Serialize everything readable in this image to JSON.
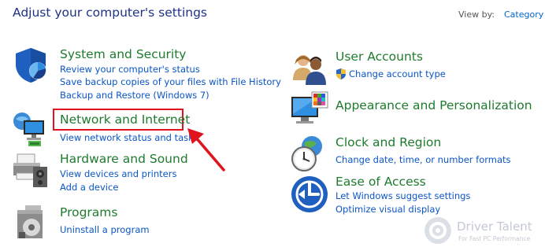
{
  "header": {
    "title": "Adjust your computer's settings",
    "view_by_label": "View by:",
    "view_by_value": "Category"
  },
  "left_categories": [
    {
      "title": "System and Security",
      "links": [
        "Review your computer's status",
        "Save backup copies of your files with File History",
        "Backup and Restore (Windows 7)"
      ],
      "icon": "shield-icon"
    },
    {
      "title": "Network and Internet",
      "links": [
        "View network status and tasks"
      ],
      "icon": "network-icon"
    },
    {
      "title": "Hardware and Sound",
      "links": [
        "View devices and printers",
        "Add a device"
      ],
      "icon": "printer-icon"
    },
    {
      "title": "Programs",
      "links": [
        "Uninstall a program"
      ],
      "icon": "programs-icon"
    }
  ],
  "right_categories": [
    {
      "title": "User Accounts",
      "links": [
        "Change account type"
      ],
      "icon": "users-icon"
    },
    {
      "title": "Appearance and Personalization",
      "links": [],
      "icon": "monitor-palette-icon"
    },
    {
      "title": "Clock and Region",
      "links": [
        "Change date, time, or number formats"
      ],
      "icon": "clock-globe-icon"
    },
    {
      "title": "Ease of Access",
      "links": [
        "Let Windows suggest settings",
        "Optimize visual display"
      ],
      "icon": "ease-of-access-icon"
    }
  ],
  "watermark": {
    "brand": "Driver Talent",
    "tagline": "For Fast PC Performance"
  },
  "colors": {
    "title_green": "#1e7b2e",
    "link_blue": "#0b56c7",
    "header_blue": "#1e3287",
    "highlight_red": "#e0141e"
  }
}
